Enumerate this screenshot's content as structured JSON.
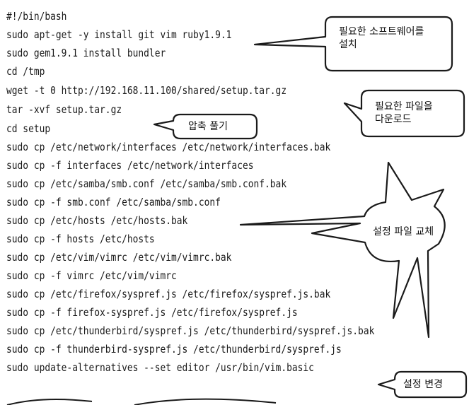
{
  "code_lines": [
    "#!/bin/bash",
    "sudo apt-get -y install git vim ruby1.9.1",
    "sudo gem1.9.1 install bundler",
    "cd /tmp",
    "wget -t 0 http://192.168.11.100/shared/setup.tar.gz",
    "tar -xvf setup.tar.gz",
    "cd setup",
    "sudo cp /etc/network/interfaces /etc/network/interfaces.bak",
    "sudo cp -f interfaces /etc/network/interfaces",
    "sudo cp /etc/samba/smb.conf /etc/samba/smb.conf.bak",
    "sudo cp -f smb.conf /etc/samba/smb.conf",
    "sudo cp /etc/hosts /etc/hosts.bak",
    "sudo cp -f hosts /etc/hosts",
    "sudo cp /etc/vim/vimrc /etc/vim/vimrc.bak",
    "sudo cp -f vimrc /etc/vim/vimrc",
    "sudo cp /etc/firefox/syspref.js /etc/firefox/syspref.js.bak",
    "sudo cp -f firefox-syspref.js /etc/firefox/syspref.js",
    "sudo cp /etc/thunderbird/syspref.js /etc/thunderbird/syspref.js.bak",
    "sudo cp -f thunderbird-syspref.js /etc/thunderbird/syspref.js",
    "sudo update-alternatives --set editor /usr/bin/vim.basic"
  ],
  "callouts": {
    "install_software": {
      "line1": "필요한 소프트웨어를",
      "line2": "설치"
    },
    "download_files": {
      "line1": "필요한 파일을",
      "line2": "다운로드"
    },
    "extract": {
      "text": "압축 풀기"
    },
    "replace_config": {
      "text": "설정 파일 교체"
    },
    "change_setting": {
      "text": "설정 변경"
    }
  }
}
